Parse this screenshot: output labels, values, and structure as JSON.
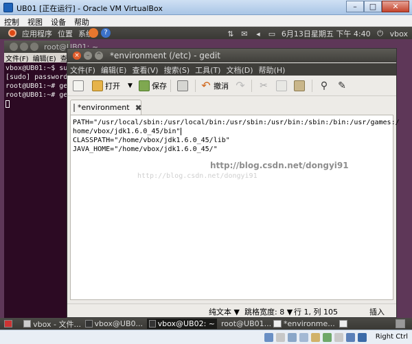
{
  "vbox": {
    "title": "UB01 [正在运行] - Oracle VM VirtualBox",
    "menu": [
      "控制",
      "视图",
      "设备",
      "帮助"
    ],
    "window_controls": {
      "minimize": "–",
      "maximize": "□",
      "close": "✕"
    },
    "host_key": "Right Ctrl"
  },
  "top_panel": {
    "menu": [
      "应用程序",
      "位置",
      "系统"
    ],
    "date_time": "6月13日星期五 下午 4:40",
    "user": "vbox"
  },
  "terminal": {
    "title": "root@UB01: ~",
    "menu": [
      "文件(F)",
      "编辑(E)",
      "查"
    ],
    "lines": [
      "vbox@UB01:~$ sud",
      "[sudo] password",
      "root@UB01:~# ge",
      "root@UB01:~# ge"
    ]
  },
  "gedit": {
    "title": "*environment (/etc) - gedit",
    "menu": [
      "文件(F)",
      "编辑(E)",
      "查看(V)",
      "搜索(S)",
      "工具(T)",
      "文档(D)",
      "帮助(H)"
    ],
    "toolbar": {
      "open": "打开",
      "save": "保存",
      "undo": "撤消"
    },
    "tab_label": "*environment",
    "lines": [
      "PATH=\"/usr/local/sbin:/usr/local/bin:/usr/sbin:/usr/bin:/sbin:/bin:/usr/games:/",
      "home/vbox/jdk1.6.0_45/bin\"",
      "CLASSPATH=\"/home/vbox/jdk1.6.0_45/lib\"",
      "JAVA_HOME=\"/home/vbox/jdk1.6.0_45/\""
    ],
    "watermark_bold": "http://blog.csdn.net/dongyi91",
    "watermark_light": "http://blog.csdn.net/dongyi91",
    "status": {
      "mode": "纯文本 ▼",
      "tab_width": "跳格宽度: 8 ▼",
      "position": "行 1, 列 105",
      "insert": "插入"
    }
  },
  "taskbar": {
    "items": [
      "vbox - 文件...",
      "vbox@UB0...",
      "vbox@UB02: ~",
      "root@UB01...",
      "*environme..."
    ]
  },
  "colors": {
    "ubuntu_orange": "#dd4814",
    "panel_dark": "#3a3935",
    "guest_bg": "#5e3758",
    "terminal_bg": "#2c0a23"
  }
}
